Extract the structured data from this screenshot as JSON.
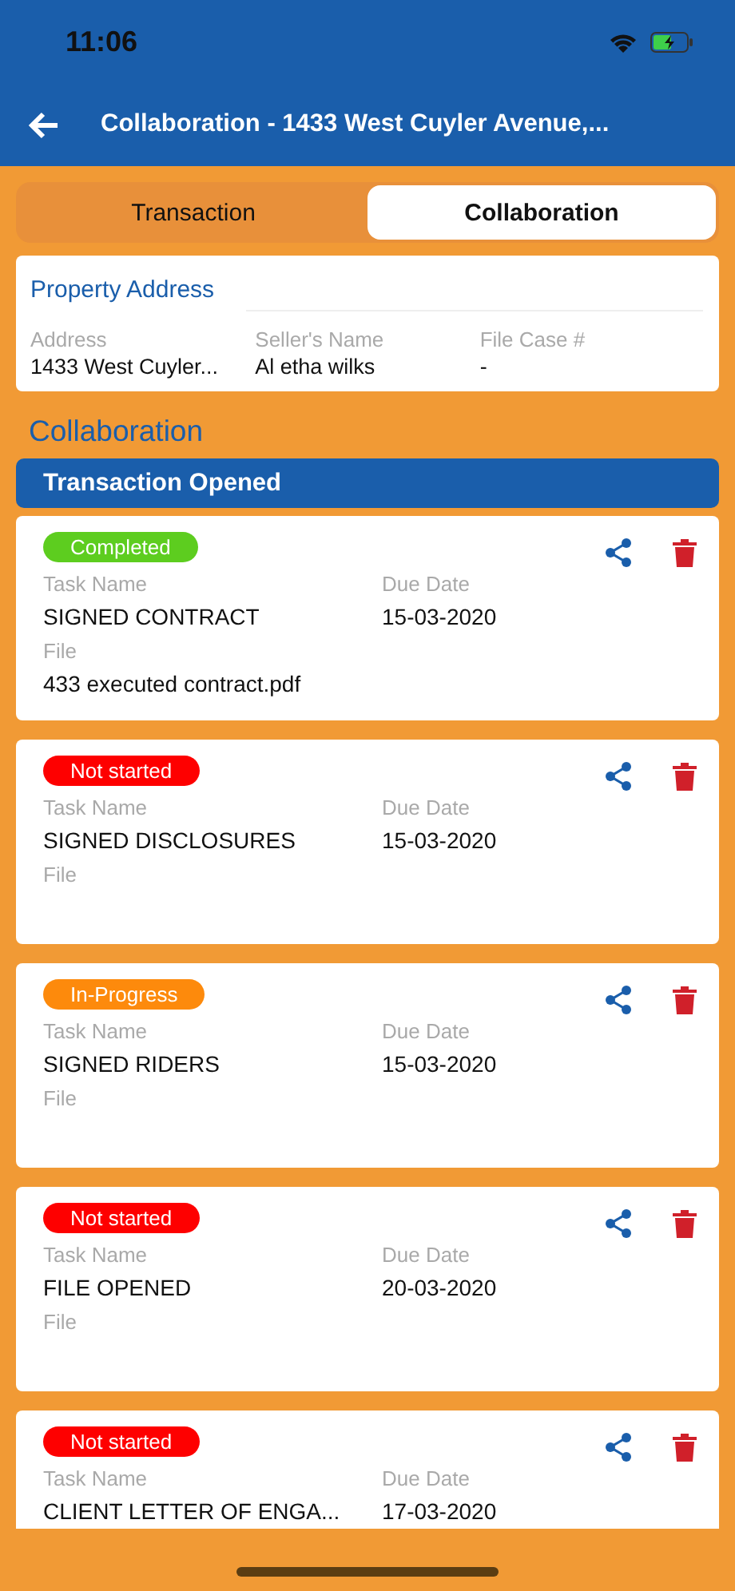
{
  "status_bar": {
    "time": "11:06"
  },
  "nav": {
    "title": "Collaboration - 1433 West Cuyler Avenue,..."
  },
  "tabs": [
    {
      "label": "Transaction",
      "selected": false
    },
    {
      "label": "Collaboration",
      "selected": true
    }
  ],
  "property": {
    "title": "Property Address",
    "fields": [
      {
        "label": "Address",
        "value": "1433 West Cuyler..."
      },
      {
        "label": "Seller's Name",
        "value": "Al etha wilks"
      },
      {
        "label": "File Case #",
        "value": "-"
      }
    ]
  },
  "section_title": "Collaboration",
  "group_title": "Transaction Opened",
  "tasks": [
    {
      "status": "Completed",
      "color": "#5dcd1f",
      "task_label": "Task Name",
      "task": "SIGNED CONTRACT",
      "due_label": "Due Date",
      "due": "15-03-2020",
      "file_label": "File",
      "file": "433 executed contract.pdf"
    },
    {
      "status": "Not started",
      "color": "#fe0000",
      "task_label": "Task Name",
      "task": "SIGNED DISCLOSURES",
      "due_label": "Due Date",
      "due": "15-03-2020",
      "file_label": "File"
    },
    {
      "status": "In-Progress",
      "color": "#fd8a0c",
      "task_label": "Task Name",
      "task": "SIGNED RIDERS",
      "due_label": "Due Date",
      "due": "15-03-2020",
      "file_label": "File"
    },
    {
      "status": "Not started",
      "color": "#fe0000",
      "task_label": "Task Name",
      "task": "FILE OPENED",
      "due_label": "Due Date",
      "due": "20-03-2020",
      "file_label": "File"
    },
    {
      "status": "Not started",
      "color": "#fe0000",
      "task_label": "Task Name",
      "task": "CLIENT LETTER OF ENGA...",
      "due_label": "Due Date",
      "due": "17-03-2020"
    }
  ]
}
